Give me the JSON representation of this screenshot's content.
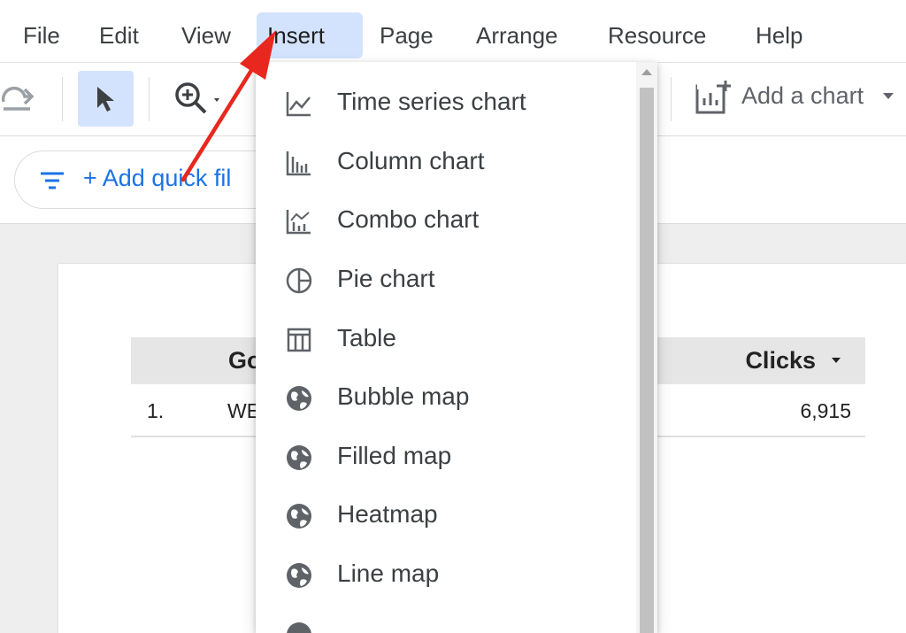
{
  "menubar": {
    "items": [
      {
        "label": "File"
      },
      {
        "label": "Edit"
      },
      {
        "label": "View"
      },
      {
        "label": "Insert",
        "active": true
      },
      {
        "label": "Page"
      },
      {
        "label": "Arrange"
      },
      {
        "label": "Resource"
      },
      {
        "label": "Help"
      }
    ]
  },
  "toolbar": {
    "add_chart_label": "Add a chart",
    "icons": [
      "redo-icon",
      "select-pointer-icon",
      "zoom-icon",
      "add-chart-icon"
    ]
  },
  "filterbar": {
    "add_quick_filter_label": "+ Add quick fil"
  },
  "table": {
    "header_dimension": "Go",
    "header_metric": "Clicks",
    "rows": [
      {
        "index": "1.",
        "dimension": "WE",
        "clicks": "6,915"
      }
    ]
  },
  "insert_menu": {
    "items": [
      {
        "label": "Time series chart",
        "icon": "time-series-icon"
      },
      {
        "label": "Column chart",
        "icon": "column-chart-icon"
      },
      {
        "label": "Combo chart",
        "icon": "combo-chart-icon"
      },
      {
        "label": "Pie chart",
        "icon": "pie-chart-icon"
      },
      {
        "label": "Table",
        "icon": "table-icon"
      },
      {
        "label": "Bubble map",
        "icon": "globe-icon"
      },
      {
        "label": "Filled map",
        "icon": "globe-icon"
      },
      {
        "label": "Heatmap",
        "icon": "globe-icon"
      },
      {
        "label": "Line map",
        "icon": "globe-icon"
      }
    ]
  },
  "colors": {
    "accent_blue": "#1a73e8",
    "active_menu_bg": "#d3e3fd",
    "annotation_red": "#e8281e"
  }
}
